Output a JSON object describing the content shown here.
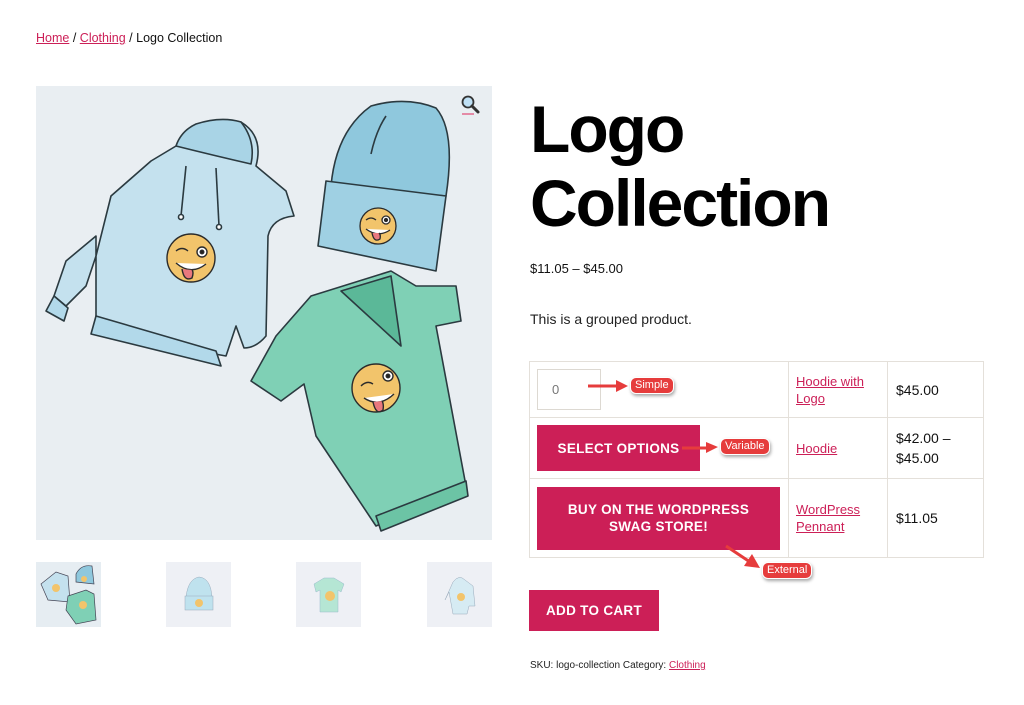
{
  "breadcrumb": {
    "items": [
      {
        "label": "Home",
        "link": true
      },
      {
        "label": "Clothing",
        "link": true
      },
      {
        "label": "Logo Collection",
        "link": false
      }
    ],
    "separator": "/"
  },
  "gallery": {
    "zoom_icon": "magnifier-icon",
    "main_image_alt": "Hoodie, beanie and t-shirt with winking emoji logo",
    "thumbnails": [
      {
        "name": "logo-collection",
        "active": true
      },
      {
        "name": "beanie",
        "active": false
      },
      {
        "name": "t-shirt",
        "active": false
      },
      {
        "name": "hoodie",
        "active": false
      }
    ]
  },
  "product": {
    "title": "Logo Collection",
    "price_range": "$11.05 – $45.00",
    "short_description": "This is a grouped product.",
    "grouped_items": [
      {
        "type": "simple",
        "quantity": "0",
        "name": "Hoodie with Logo",
        "price": "$45.00",
        "annotation": "Simple"
      },
      {
        "type": "variable",
        "button": "SELECT OPTIONS",
        "name": "Hoodie",
        "price": "$42.00 – $45.00",
        "annotation": "Variable"
      },
      {
        "type": "external",
        "button": "BUY ON THE WORDPRESS SWAG STORE!",
        "name": "WordPress Pennant",
        "price": "$11.05",
        "annotation": "External"
      }
    ],
    "add_to_cart_label": "ADD TO CART",
    "meta": {
      "sku_label": "SKU:",
      "sku": "logo-collection",
      "category_label": "Category:",
      "category": "Clothing"
    }
  },
  "colors": {
    "accent": "#cc1f57",
    "annotation": "#e63c3c",
    "border": "#e4e0da"
  }
}
